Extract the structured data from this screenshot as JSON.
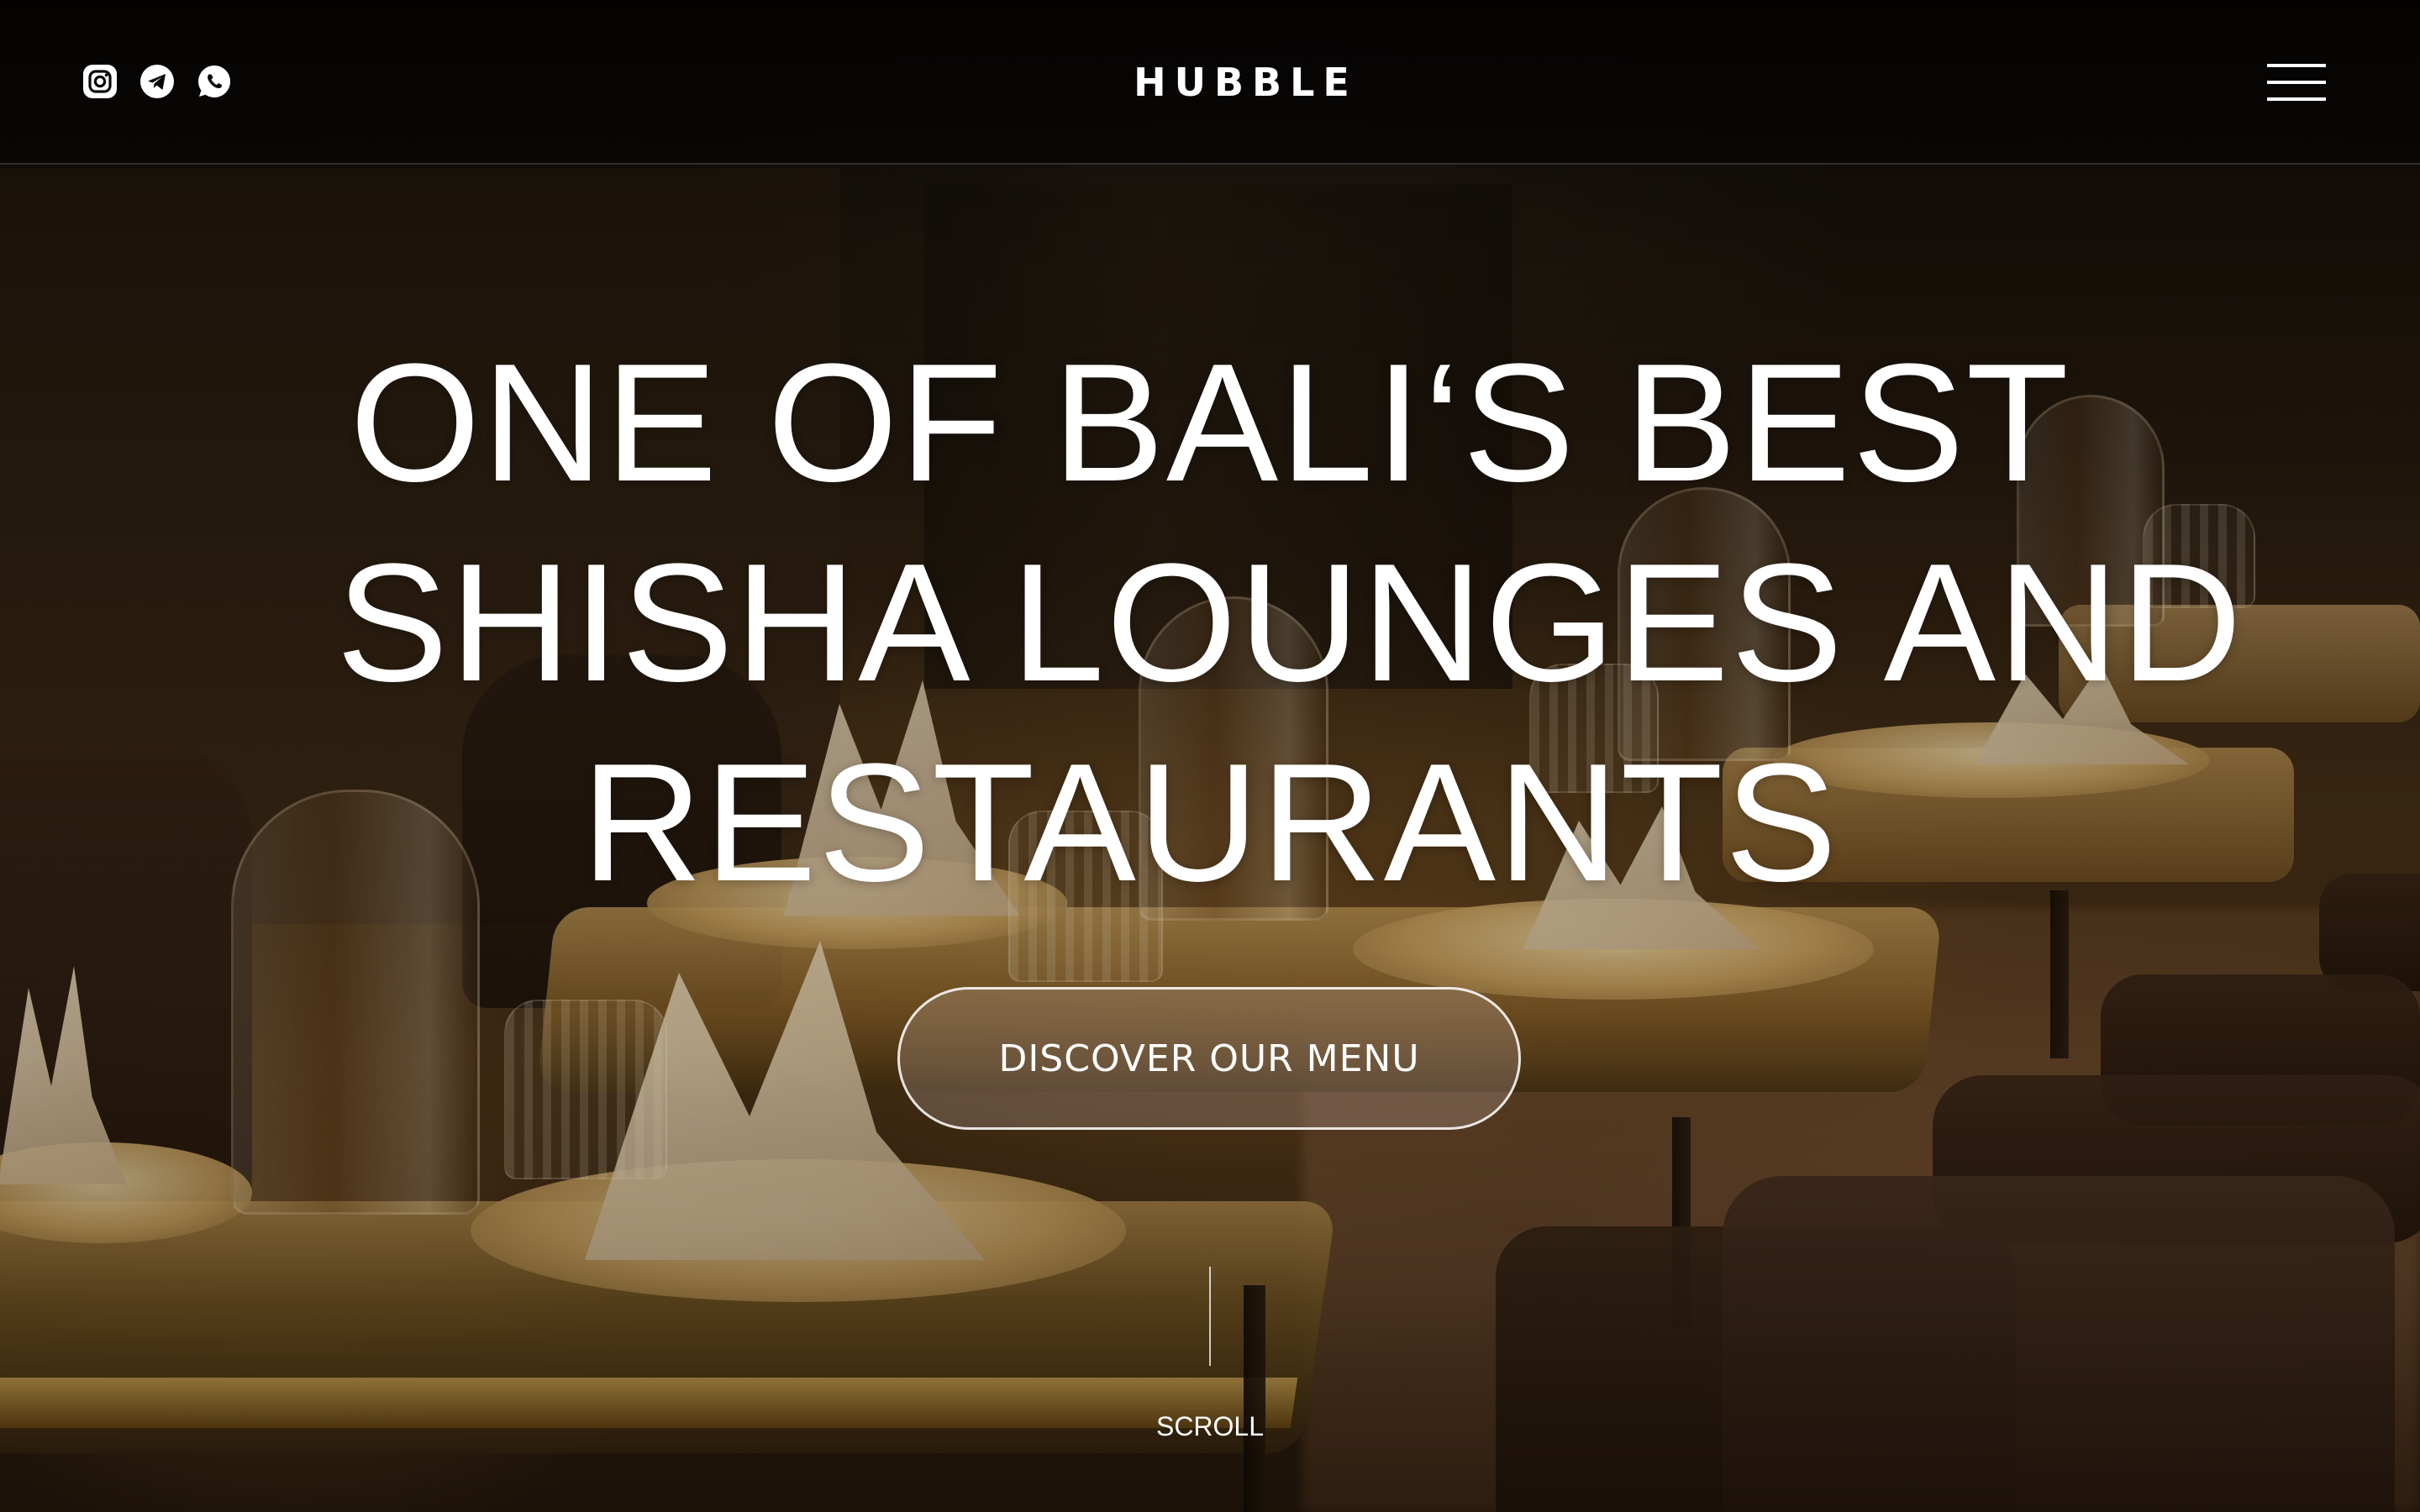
{
  "header": {
    "logo": "HUBBLE",
    "socials": [
      {
        "icon": "instagram-icon"
      },
      {
        "icon": "telegram-icon"
      },
      {
        "icon": "whatsapp-icon"
      }
    ],
    "menu_icon": "hamburger-menu-icon"
  },
  "hero": {
    "headline_lines": [
      "ONE OF BALI‘S BEST",
      "SHISHA LOUNGES AND",
      "RESTAURANTS"
    ],
    "cta_label": "DISCOVER OUR MENU",
    "scroll_label": "SCROLL"
  },
  "colors": {
    "text": "#ffffff",
    "header_bg": "#050403",
    "accent_gold": "#b08a4a"
  }
}
